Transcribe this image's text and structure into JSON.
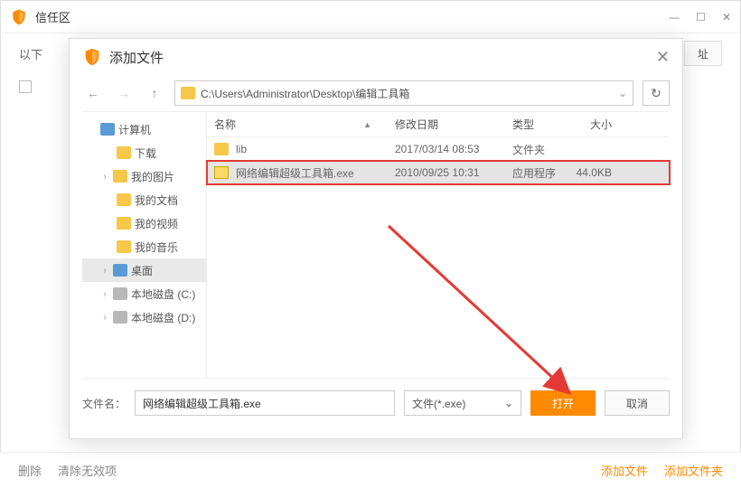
{
  "main": {
    "title": "信任区",
    "toolbar_prefix": "以下",
    "address_btn": "址",
    "footer_left": [
      "删除",
      "清除无效项"
    ],
    "footer_right": [
      "添加文件",
      "添加文件夹"
    ]
  },
  "dialog": {
    "title": "添加文件",
    "path": "C:\\Users\\Administrator\\Desktop\\编辑工具箱",
    "tree": [
      {
        "label": "计算机",
        "icon": "ico-computer",
        "expandable": false,
        "indent": 0
      },
      {
        "label": "下载",
        "icon": "ico-download",
        "expandable": false,
        "indent": 2
      },
      {
        "label": "我的图片",
        "icon": "ico-folder",
        "expandable": true,
        "indent": 1
      },
      {
        "label": "我的文档",
        "icon": "ico-folder",
        "expandable": false,
        "indent": 2
      },
      {
        "label": "我的视频",
        "icon": "ico-folder",
        "expandable": false,
        "indent": 2
      },
      {
        "label": "我的音乐",
        "icon": "ico-folder",
        "expandable": false,
        "indent": 2
      },
      {
        "label": "桌面",
        "icon": "ico-desktop",
        "expandable": true,
        "indent": 1,
        "selected": true
      },
      {
        "label": "本地磁盘 (C:)",
        "icon": "ico-disk",
        "expandable": true,
        "indent": 1
      },
      {
        "label": "本地磁盘 (D:)",
        "icon": "ico-disk",
        "expandable": true,
        "indent": 1
      }
    ],
    "columns": {
      "name": "名称",
      "date": "修改日期",
      "type": "类型",
      "size": "大小"
    },
    "files": [
      {
        "name": "lib",
        "date": "2017/03/14 08:53",
        "type": "文件夹",
        "size": "",
        "icon": "ico-folder2",
        "selected": false,
        "highlighted": false
      },
      {
        "name": "网络编辑超级工具箱.exe",
        "date": "2010/09/25 10:31",
        "type": "应用程序",
        "size": "44.0KB",
        "icon": "ico-exe",
        "selected": true,
        "highlighted": true
      }
    ],
    "filename_label": "文件名：",
    "filename_value": "网络编辑超级工具箱.exe",
    "filter": "文件(*.exe)",
    "open_btn": "打开",
    "cancel_btn": "取消"
  }
}
